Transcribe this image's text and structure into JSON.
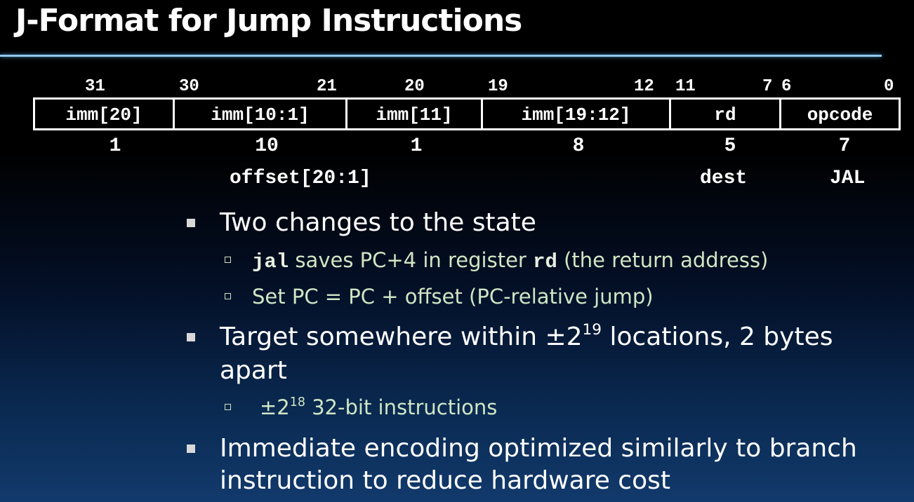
{
  "title": "J-Format for Jump Instructions",
  "bit_positions": {
    "b31": "31",
    "b30": "30",
    "b21": "21",
    "b20": "20",
    "b19": "19",
    "b12": "12",
    "b11": "11",
    "b7": "7",
    "b6": "6",
    "b0": "0"
  },
  "fields": [
    {
      "label": "imm[20]",
      "width": "1"
    },
    {
      "label": "imm[10:1]",
      "width": "10"
    },
    {
      "label": "imm[11]",
      "width": "1"
    },
    {
      "label": "imm[19:12]",
      "width": "8"
    },
    {
      "label": "rd",
      "width": "5"
    },
    {
      "label": "opcode",
      "width": "7"
    }
  ],
  "sub_labels": {
    "offset": "offset[20:1]",
    "dest": "dest",
    "jal": "JAL"
  },
  "bullets": {
    "b1": {
      "text": "Two changes to the state",
      "sub1": {
        "code1": "jal",
        "text1": " saves PC+4 in register ",
        "code2": "rd",
        "text2": " (the return address)"
      },
      "sub2": "Set PC = PC + offset (PC-relative jump)"
    },
    "b2": {
      "prefix": "Target somewhere within  ±2",
      "exp": "19",
      "suffix": " locations, 2 bytes",
      "line2": "apart",
      "sub1": {
        "prefix": "±2",
        "exp": "18",
        "suffix": " 32-bit instructions"
      }
    },
    "b3": {
      "line1": "Immediate encoding optimized similarly to branch",
      "line2": "instruction to reduce hardware cost"
    }
  }
}
